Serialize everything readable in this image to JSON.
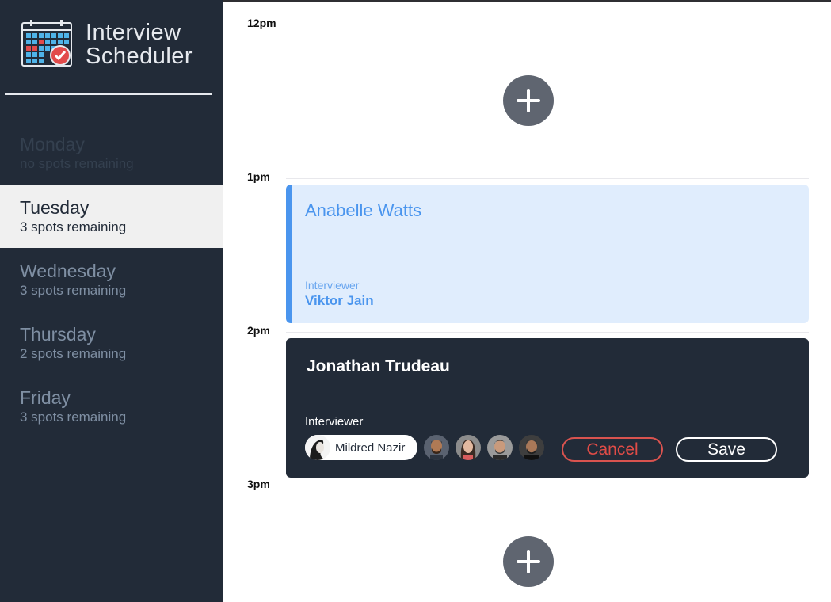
{
  "app": {
    "title_line1": "Interview",
    "title_line2": "Scheduler",
    "logo_icon": "calendar-check-icon"
  },
  "sidebar": {
    "days": [
      {
        "name": "Monday",
        "spots": "no spots remaining",
        "state": "full"
      },
      {
        "name": "Tuesday",
        "spots": "3 spots remaining",
        "state": "selected"
      },
      {
        "name": "Wednesday",
        "spots": "3 spots remaining",
        "state": "normal"
      },
      {
        "name": "Thursday",
        "spots": "2 spots remaining",
        "state": "normal"
      },
      {
        "name": "Friday",
        "spots": "3 spots remaining",
        "state": "normal"
      }
    ]
  },
  "schedule": {
    "times": [
      "12pm",
      "1pm",
      "2pm",
      "3pm"
    ],
    "add_icon": "plus-icon",
    "appointment": {
      "student": "Anabelle Watts",
      "interviewer_label": "Interviewer",
      "interviewer": "Viktor Jain"
    },
    "form": {
      "student_value": "Jonathan Trudeau",
      "interviewer_label": "Interviewer",
      "selected_interviewer": "Mildred Nazir",
      "other_interviewer_count": 4,
      "cancel_label": "Cancel",
      "save_label": "Save"
    }
  },
  "colors": {
    "sidebar_bg": "#222b38",
    "selected_day_bg": "#f0f0f0",
    "appointment_bg": "#e0edfd",
    "accent_blue": "#4a95ee",
    "cancel_red": "#d9534f",
    "add_button": "#5f6570"
  }
}
